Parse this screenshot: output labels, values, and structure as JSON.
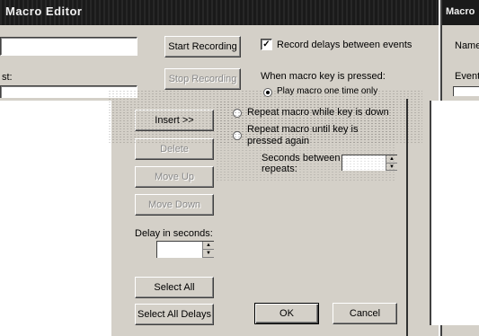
{
  "window": {
    "title": "Macro Editor",
    "right_title": "Macro"
  },
  "recording": {
    "start_label": "Start Recording",
    "stop_label": "Stop Recording",
    "record_delays_label": "Record delays between events",
    "record_delays_checked": true
  },
  "left": {
    "partial_label": "st:"
  },
  "playback": {
    "heading": "When macro key is pressed:",
    "options": [
      {
        "label": "Play macro one time only",
        "checked": true
      },
      {
        "label": "Repeat macro while key is down",
        "checked": false
      },
      {
        "label": "Repeat macro until key is pressed again",
        "checked": false
      }
    ],
    "seconds_label": "Seconds between repeats:",
    "seconds_value": ""
  },
  "actions": {
    "insert": "Insert >>",
    "delete": "Delete",
    "move_up": "Move Up",
    "move_down": "Move Down",
    "delay_label": "Delay in seconds:",
    "delay_value": "",
    "select_all": "Select All",
    "select_all_delays": "Select All Delays"
  },
  "dialog": {
    "ok": "OK",
    "cancel": "Cancel"
  },
  "right_panel": {
    "name_label": "Name:",
    "event_label": "Event"
  },
  "icons": {
    "check": "checkmark-icon",
    "spin_up": "spin-up-icon",
    "spin_down": "spin-down-icon"
  }
}
